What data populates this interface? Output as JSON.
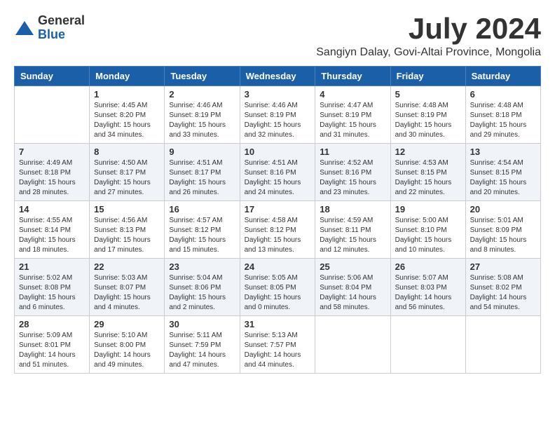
{
  "logo": {
    "general": "General",
    "blue": "Blue"
  },
  "title": "July 2024",
  "subtitle": "Sangiyn Dalay, Govi-Altai Province, Mongolia",
  "days_of_week": [
    "Sunday",
    "Monday",
    "Tuesday",
    "Wednesday",
    "Thursday",
    "Friday",
    "Saturday"
  ],
  "weeks": [
    [
      {
        "day": "",
        "info": ""
      },
      {
        "day": "1",
        "info": "Sunrise: 4:45 AM\nSunset: 8:20 PM\nDaylight: 15 hours\nand 34 minutes."
      },
      {
        "day": "2",
        "info": "Sunrise: 4:46 AM\nSunset: 8:19 PM\nDaylight: 15 hours\nand 33 minutes."
      },
      {
        "day": "3",
        "info": "Sunrise: 4:46 AM\nSunset: 8:19 PM\nDaylight: 15 hours\nand 32 minutes."
      },
      {
        "day": "4",
        "info": "Sunrise: 4:47 AM\nSunset: 8:19 PM\nDaylight: 15 hours\nand 31 minutes."
      },
      {
        "day": "5",
        "info": "Sunrise: 4:48 AM\nSunset: 8:19 PM\nDaylight: 15 hours\nand 30 minutes."
      },
      {
        "day": "6",
        "info": "Sunrise: 4:48 AM\nSunset: 8:18 PM\nDaylight: 15 hours\nand 29 minutes."
      }
    ],
    [
      {
        "day": "7",
        "info": "Sunrise: 4:49 AM\nSunset: 8:18 PM\nDaylight: 15 hours\nand 28 minutes."
      },
      {
        "day": "8",
        "info": "Sunrise: 4:50 AM\nSunset: 8:17 PM\nDaylight: 15 hours\nand 27 minutes."
      },
      {
        "day": "9",
        "info": "Sunrise: 4:51 AM\nSunset: 8:17 PM\nDaylight: 15 hours\nand 26 minutes."
      },
      {
        "day": "10",
        "info": "Sunrise: 4:51 AM\nSunset: 8:16 PM\nDaylight: 15 hours\nand 24 minutes."
      },
      {
        "day": "11",
        "info": "Sunrise: 4:52 AM\nSunset: 8:16 PM\nDaylight: 15 hours\nand 23 minutes."
      },
      {
        "day": "12",
        "info": "Sunrise: 4:53 AM\nSunset: 8:15 PM\nDaylight: 15 hours\nand 22 minutes."
      },
      {
        "day": "13",
        "info": "Sunrise: 4:54 AM\nSunset: 8:15 PM\nDaylight: 15 hours\nand 20 minutes."
      }
    ],
    [
      {
        "day": "14",
        "info": "Sunrise: 4:55 AM\nSunset: 8:14 PM\nDaylight: 15 hours\nand 18 minutes."
      },
      {
        "day": "15",
        "info": "Sunrise: 4:56 AM\nSunset: 8:13 PM\nDaylight: 15 hours\nand 17 minutes."
      },
      {
        "day": "16",
        "info": "Sunrise: 4:57 AM\nSunset: 8:12 PM\nDaylight: 15 hours\nand 15 minutes."
      },
      {
        "day": "17",
        "info": "Sunrise: 4:58 AM\nSunset: 8:12 PM\nDaylight: 15 hours\nand 13 minutes."
      },
      {
        "day": "18",
        "info": "Sunrise: 4:59 AM\nSunset: 8:11 PM\nDaylight: 15 hours\nand 12 minutes."
      },
      {
        "day": "19",
        "info": "Sunrise: 5:00 AM\nSunset: 8:10 PM\nDaylight: 15 hours\nand 10 minutes."
      },
      {
        "day": "20",
        "info": "Sunrise: 5:01 AM\nSunset: 8:09 PM\nDaylight: 15 hours\nand 8 minutes."
      }
    ],
    [
      {
        "day": "21",
        "info": "Sunrise: 5:02 AM\nSunset: 8:08 PM\nDaylight: 15 hours\nand 6 minutes."
      },
      {
        "day": "22",
        "info": "Sunrise: 5:03 AM\nSunset: 8:07 PM\nDaylight: 15 hours\nand 4 minutes."
      },
      {
        "day": "23",
        "info": "Sunrise: 5:04 AM\nSunset: 8:06 PM\nDaylight: 15 hours\nand 2 minutes."
      },
      {
        "day": "24",
        "info": "Sunrise: 5:05 AM\nSunset: 8:05 PM\nDaylight: 15 hours\nand 0 minutes."
      },
      {
        "day": "25",
        "info": "Sunrise: 5:06 AM\nSunset: 8:04 PM\nDaylight: 14 hours\nand 58 minutes."
      },
      {
        "day": "26",
        "info": "Sunrise: 5:07 AM\nSunset: 8:03 PM\nDaylight: 14 hours\nand 56 minutes."
      },
      {
        "day": "27",
        "info": "Sunrise: 5:08 AM\nSunset: 8:02 PM\nDaylight: 14 hours\nand 54 minutes."
      }
    ],
    [
      {
        "day": "28",
        "info": "Sunrise: 5:09 AM\nSunset: 8:01 PM\nDaylight: 14 hours\nand 51 minutes."
      },
      {
        "day": "29",
        "info": "Sunrise: 5:10 AM\nSunset: 8:00 PM\nDaylight: 14 hours\nand 49 minutes."
      },
      {
        "day": "30",
        "info": "Sunrise: 5:11 AM\nSunset: 7:59 PM\nDaylight: 14 hours\nand 47 minutes."
      },
      {
        "day": "31",
        "info": "Sunrise: 5:13 AM\nSunset: 7:57 PM\nDaylight: 14 hours\nand 44 minutes."
      },
      {
        "day": "",
        "info": ""
      },
      {
        "day": "",
        "info": ""
      },
      {
        "day": "",
        "info": ""
      }
    ]
  ]
}
